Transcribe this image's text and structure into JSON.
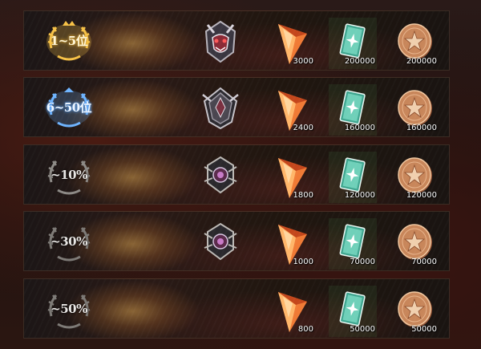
{
  "rows": [
    {
      "rank": "1~5位",
      "rank_style": "gold",
      "emblem_icon": "demon-emblem-icon",
      "rewards": [
        {
          "icon": "crystal-icon",
          "qty": "3000"
        },
        {
          "icon": "card-icon",
          "qty": "200000"
        },
        {
          "icon": "coin-icon",
          "qty": "200000"
        }
      ]
    },
    {
      "rank": "6~50位",
      "rank_style": "blue",
      "emblem_icon": "crest-emblem-icon",
      "rewards": [
        {
          "icon": "crystal-icon",
          "qty": "2400"
        },
        {
          "icon": "card-icon",
          "qty": "160000"
        },
        {
          "icon": "coin-icon",
          "qty": "160000"
        }
      ]
    },
    {
      "rank": "~10%",
      "rank_style": "silver",
      "emblem_icon": "gem-emblem-icon",
      "rewards": [
        {
          "icon": "crystal-icon",
          "qty": "1800"
        },
        {
          "icon": "card-icon",
          "qty": "120000"
        },
        {
          "icon": "coin-icon",
          "qty": "120000"
        }
      ]
    },
    {
      "rank": "~30%",
      "rank_style": "silver",
      "emblem_icon": "gem-emblem-icon",
      "rewards": [
        {
          "icon": "crystal-icon",
          "qty": "1000"
        },
        {
          "icon": "card-icon",
          "qty": "70000"
        },
        {
          "icon": "coin-icon",
          "qty": "70000"
        }
      ]
    },
    {
      "rank": "~50%",
      "rank_style": "silver",
      "emblem_icon": null,
      "rewards": [
        {
          "icon": "crystal-icon",
          "qty": "800"
        },
        {
          "icon": "card-icon",
          "qty": "50000"
        },
        {
          "icon": "coin-icon",
          "qty": "50000"
        }
      ]
    }
  ],
  "colors": {
    "gold": "#f7c247",
    "blue": "#6eb4ff",
    "silver": "#bdbab6",
    "crystal": "#f07a35",
    "card": "#3fa58f",
    "coin": "#c8865a"
  }
}
